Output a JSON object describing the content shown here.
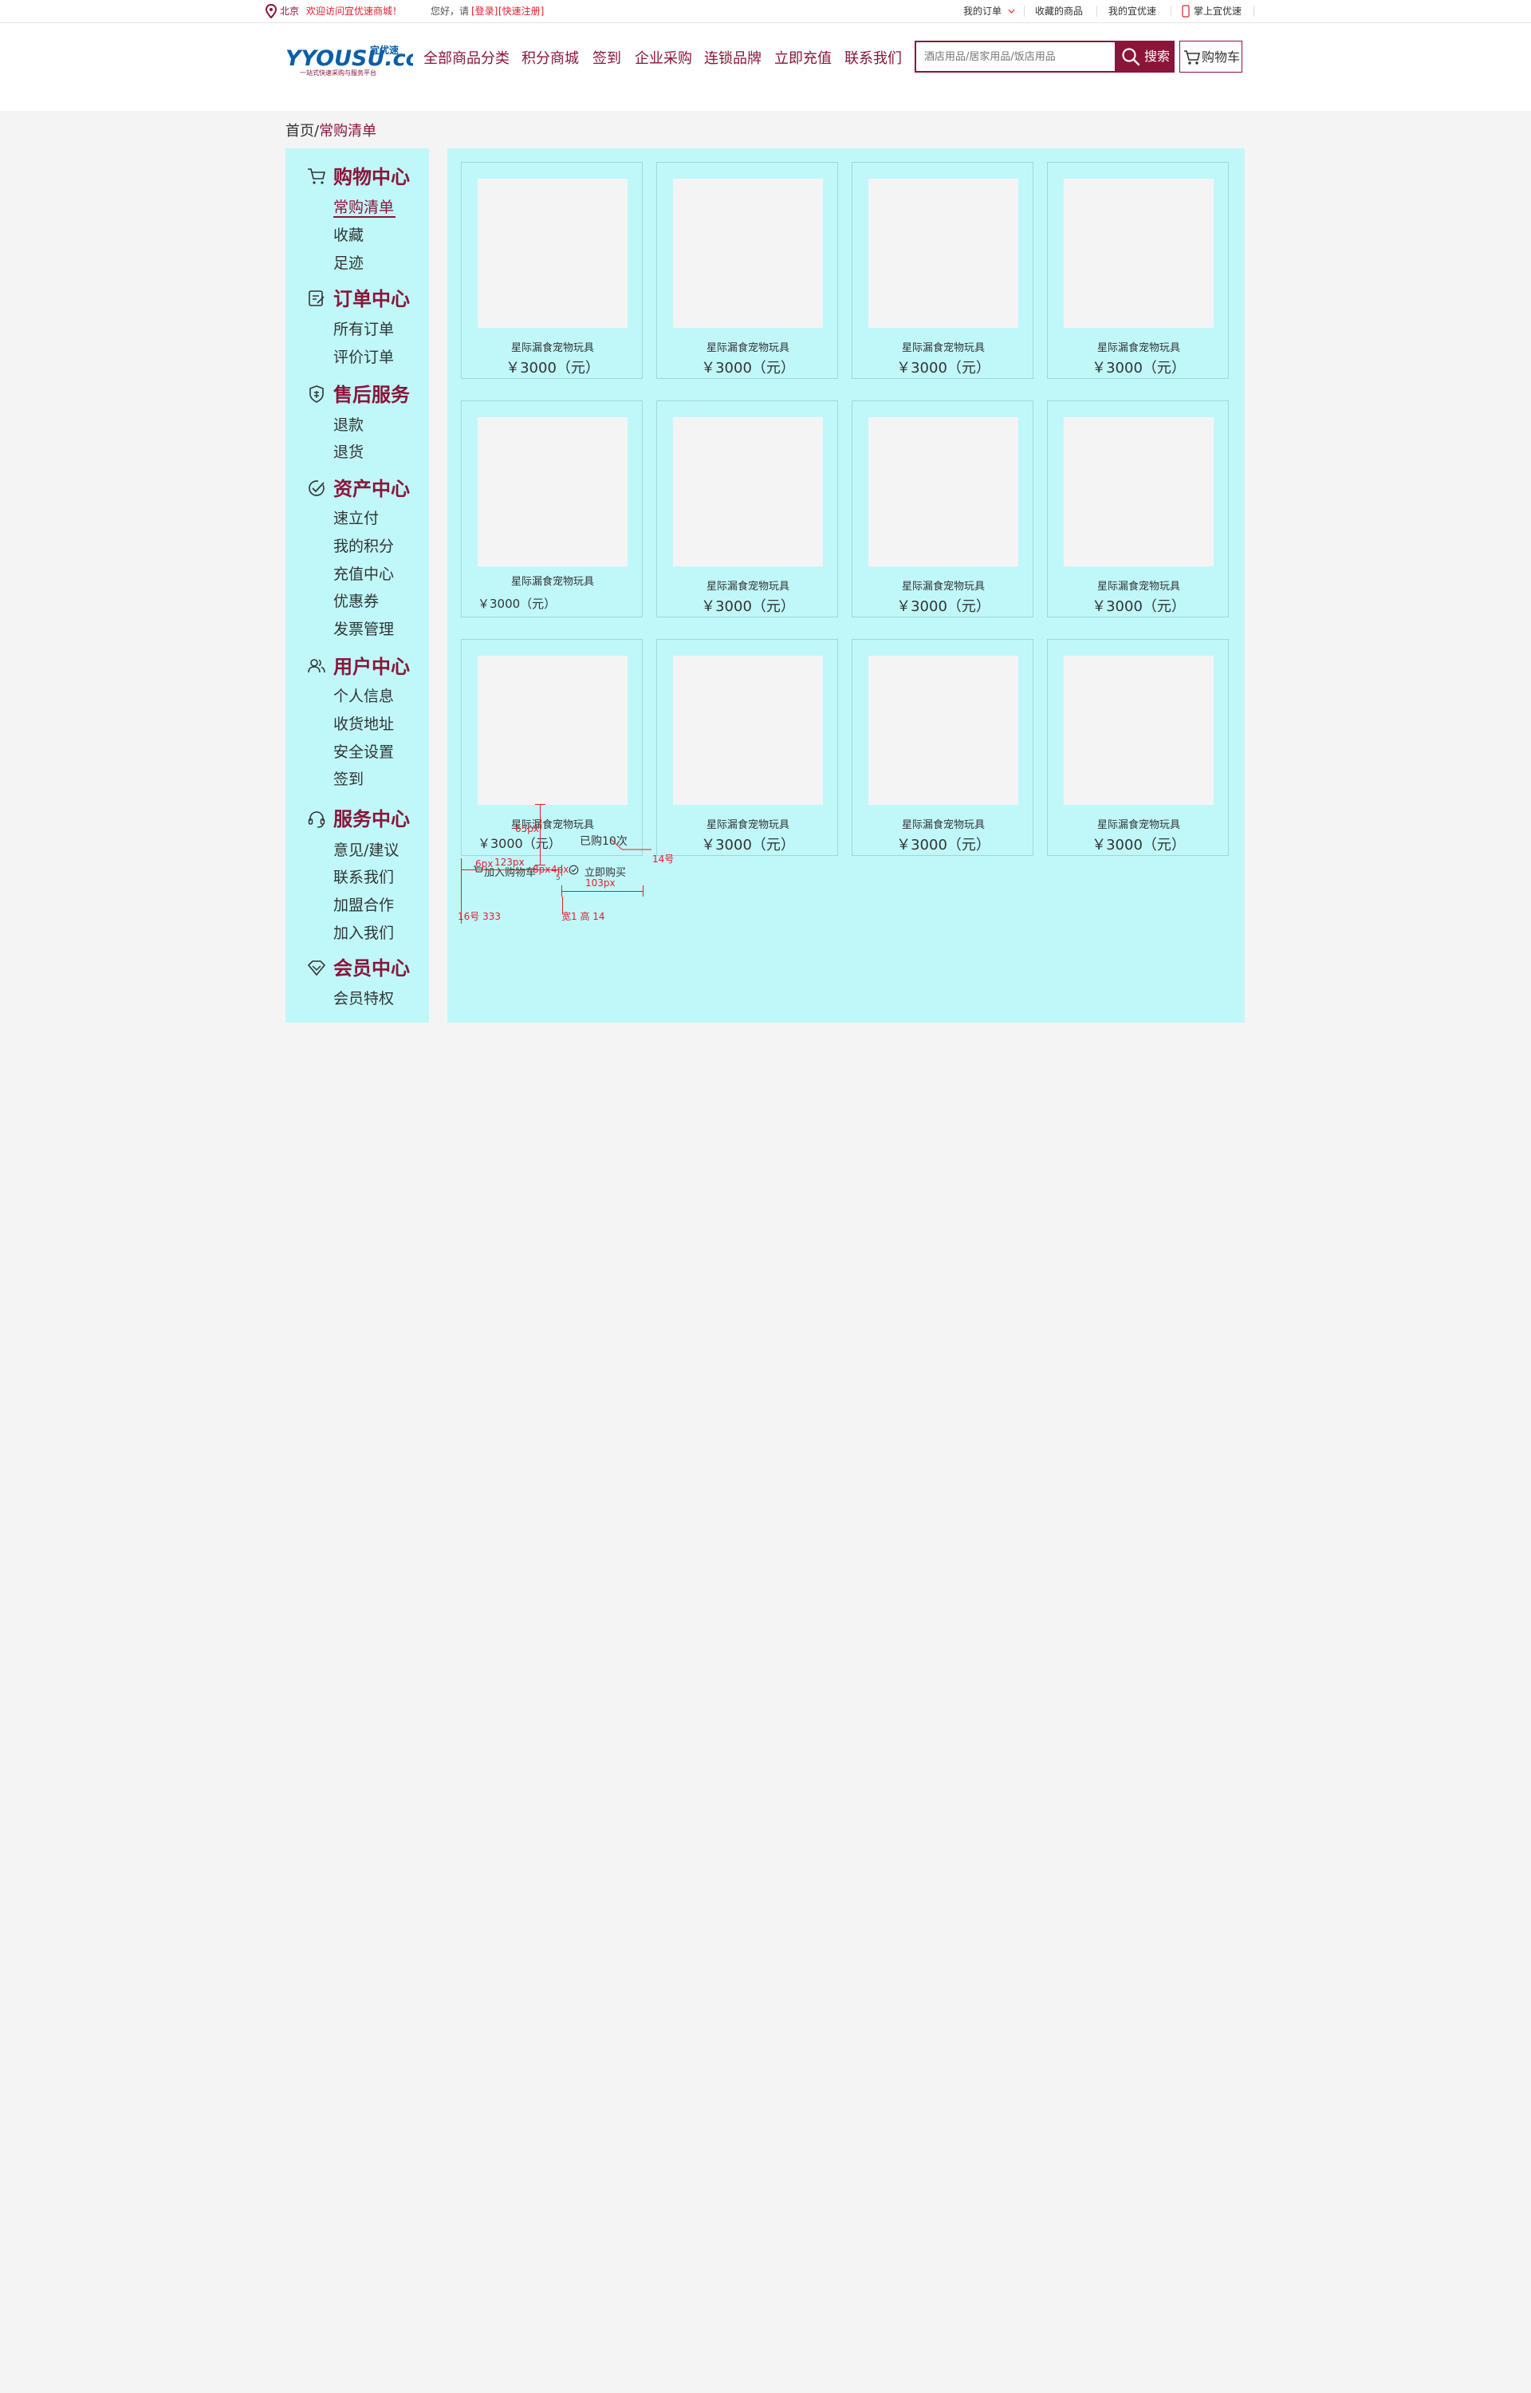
{
  "topbar": {
    "location": "北京",
    "welcome": "欢迎访问宜优速商城！",
    "greeting": "您好，请",
    "login": "[登录]",
    "register": "[快速注册]",
    "my_orders": "我的订单",
    "favorites": "收藏的商品",
    "my_account": "我的宜优速",
    "mobile": "掌上宜优速"
  },
  "header": {
    "logo_text": "YYOUSU.com",
    "logo_cn": "宜优速",
    "logo_slogan": "一站式快速采购与服务平台",
    "nav": [
      "全部商品分类",
      "积分商城",
      "签到",
      "企业采购",
      "连锁品牌",
      "立即充值",
      "联系我们"
    ],
    "search_placeholder": "酒店用品/居家用品/饭店用品",
    "search_button": "搜索",
    "cart_button": "购物车"
  },
  "breadcrumb": {
    "home": "首页",
    "separator": "/",
    "current": "常购清单"
  },
  "sidebar": {
    "sections": [
      {
        "title": "购物中心",
        "icon": "cart-icon",
        "links": [
          "常购清单",
          "收藏",
          "足迹"
        ]
      },
      {
        "title": "订单中心",
        "icon": "order-icon",
        "links": [
          "所有订单",
          "评价订单"
        ]
      },
      {
        "title": "售后服务",
        "icon": "shield-icon",
        "links": [
          "退款",
          "退货"
        ]
      },
      {
        "title": "资产中心",
        "icon": "check-circle-icon",
        "links": [
          "速立付",
          "我的积分",
          "充值中心",
          "优惠券",
          "发票管理"
        ]
      },
      {
        "title": "用户中心",
        "icon": "users-icon",
        "links": [
          "个人信息",
          "收货地址",
          "安全设置",
          "签到"
        ]
      },
      {
        "title": "服务中心",
        "icon": "headset-icon",
        "links": [
          "意见/建议",
          "联系我们",
          "加盟合作",
          "加入我们"
        ]
      },
      {
        "title": "会员中心",
        "icon": "diamond-icon",
        "links": [
          "会员特权"
        ]
      }
    ]
  },
  "products": [
    {
      "name": "星际漏食宠物玩具",
      "price": "￥3000（元）"
    },
    {
      "name": "星际漏食宠物玩具",
      "price": "￥3000（元）"
    },
    {
      "name": "星际漏食宠物玩具",
      "price": "￥3000（元）"
    },
    {
      "name": "星际漏食宠物玩具",
      "price": "￥3000（元）"
    },
    {
      "name": "星际漏食宠物玩具",
      "price": "￥3000（元）"
    },
    {
      "name": "星际漏食宠物玩具",
      "price": "￥3000（元）"
    },
    {
      "name": "星际漏食宠物玩具",
      "price": "￥3000（元）"
    },
    {
      "name": "星际漏食宠物玩具",
      "price": "￥3000（元）"
    },
    {
      "name": "星际漏食宠物玩具",
      "price": "￥3000（元）"
    },
    {
      "name": "星际漏食宠物玩具",
      "price": "￥3000（元）"
    },
    {
      "name": "星际漏食宠物玩具",
      "price": "￥3000（元）"
    },
    {
      "name": "星际漏食宠物玩具",
      "price": "￥3000（元）"
    }
  ],
  "hover_card": {
    "bought": "已购10次",
    "add_to_cart": "加入购物车",
    "buy_now": "立即购买"
  },
  "annotations": {
    "height_label": "65px",
    "size_14": "14号",
    "px123": "123px",
    "px6": "6px",
    "px8": "8px",
    "px4": "4px",
    "px103": "103px",
    "font16": "16号 333",
    "border": "宽1 高 14",
    "s5": "5"
  },
  "colors": {
    "brand": "#8a1538",
    "panel": "#c0f8fa",
    "annotation": "#e0202c"
  }
}
